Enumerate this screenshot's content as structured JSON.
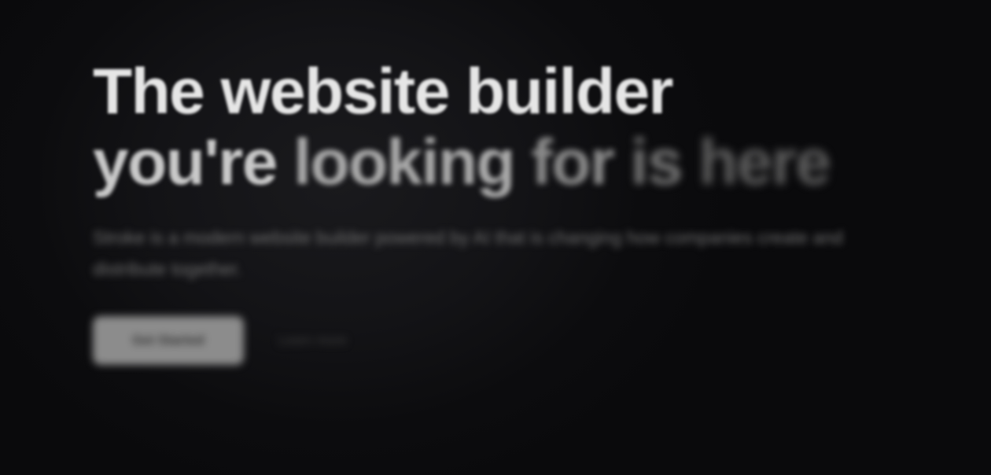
{
  "hero": {
    "headline_line1": "The website builder",
    "headline_line2_words": [
      "you're",
      "looking",
      "for",
      "is",
      "here"
    ],
    "subtext": "Stroke is a modern website builder powered by AI that is changing how companies create and distribute together.",
    "primary_button_label": "Get Started",
    "secondary_button_label": "Learn more"
  },
  "colors": {
    "background": "#0b0b0d",
    "headline_bright": "#e6e6e6",
    "button_bg": "#8c8c8c"
  }
}
